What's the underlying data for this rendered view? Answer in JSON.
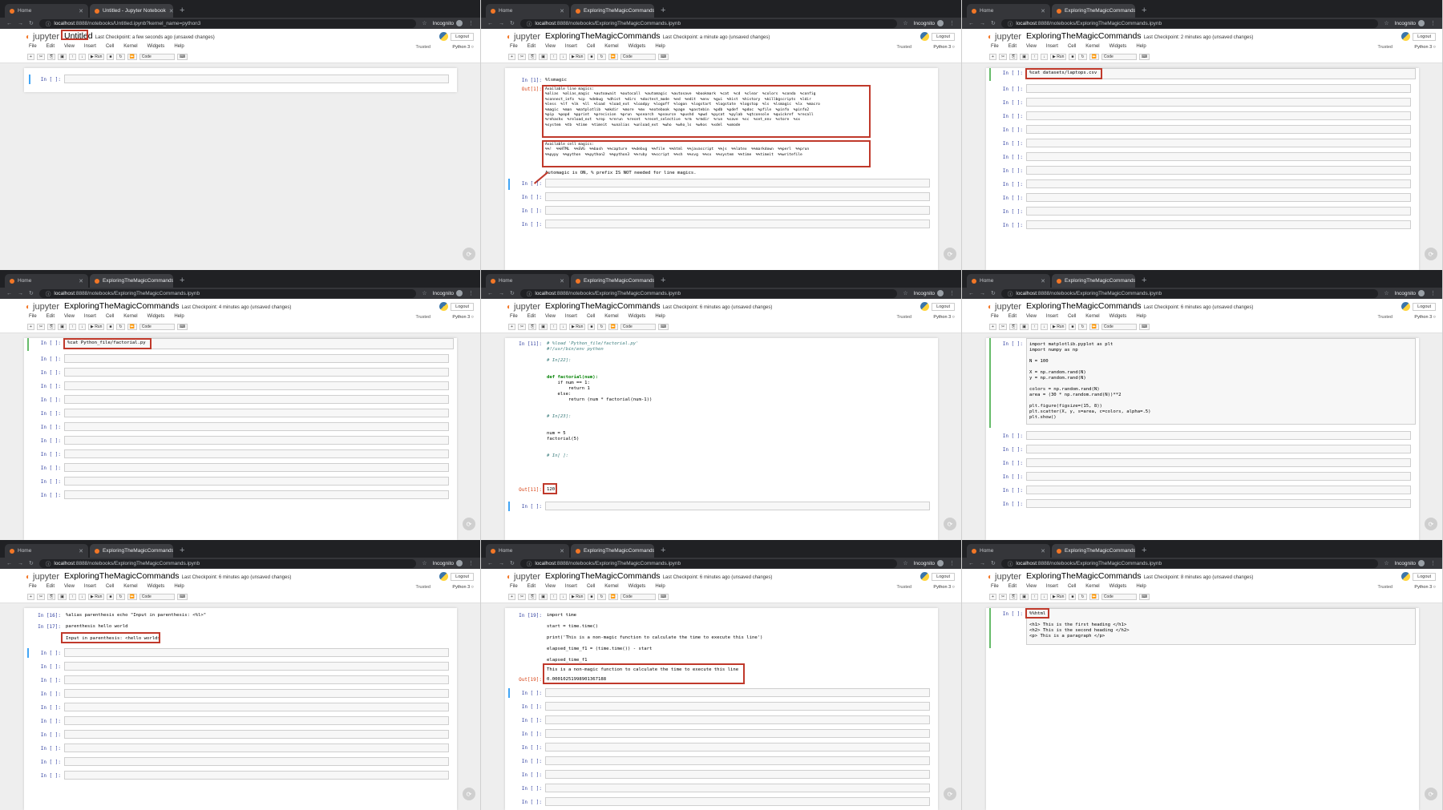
{
  "browser": {
    "home_tab": "Home",
    "new_tab": "+",
    "incognito": "Incognito",
    "host": "localhost",
    "url_rest": ":8888/notebooks/ExploringTheMagicCommands.ipynb",
    "url_untitled_rest": ":8888/notebooks/Untitled.ipynb?kernel_name=python3",
    "active_tab": "ExploringTheMagicCommands",
    "untitled_tab": "Untitled - Jupyter Notebook"
  },
  "jupyter": {
    "logo": "jupyter",
    "logout": "Logout",
    "trusted": "Trusted",
    "kernel": "Python 3",
    "menu": [
      "File",
      "Edit",
      "View",
      "Insert",
      "Cell",
      "Kernel",
      "Widgets",
      "Help"
    ],
    "toolbar": [
      "+",
      "✂",
      "⎘",
      "▣",
      "↑",
      "↓",
      "▶ Run",
      "■",
      "↻",
      "⏩"
    ],
    "cell_type": "Code",
    "unsaved": "(unsaved changes)",
    "empty_prompt": "In [ ]:"
  },
  "panels": [
    {
      "title": "Untitled",
      "checkpoint": "Last Checkpoint: a few seconds ago",
      "code": ""
    },
    {
      "title": "ExploringTheMagicCommands",
      "checkpoint": "Last Checkpoint: a minute ago",
      "in_prompt": "In [1]:",
      "out_prompt": "Out[1]:",
      "code": "%lsmagic",
      "output_line": "Available line magics:\n%alias  %alias_magic  %autoawait  %autocall  %automagic  %autosave  %bookmark  %cat  %cd  %clear  %colors  %conda  %config\n%connect_info  %cp  %debug  %dhist  %dirs  %doctest_mode  %ed  %edit  %env  %gui  %hist  %history  %killbgscripts  %ldir\n%less  %lf  %lk  %ll  %load  %load_ext  %loadpy  %logoff  %logon  %logstart  %logstate  %logstop  %ls  %lsmagic  %lx  %macro\n%magic  %man  %matplotlib  %mkdir  %more  %mv  %notebook  %page  %pastebin  %pdb  %pdef  %pdoc  %pfile  %pinfo  %pinfo2\n%pip  %popd  %pprint  %precision  %prun  %psearch  %psource  %pushd  %pwd  %pycat  %pylab  %qtconsole  %quickref  %recall\n%rehashx  %reload_ext  %rep  %rerun  %reset  %reset_selective  %rm  %rmdir  %run  %save  %sc  %set_env  %store  %sx\n%system  %tb  %time  %timeit  %unalias  %unload_ext  %who  %who_ls  %whos  %xdel  %xmode",
      "output_cell": "Available cell magics:\n%%!  %%HTML  %%SVG  %%bash  %%capture  %%debug  %%file  %%html  %%javascript  %%js  %%latex  %%markdown  %%perl  %%prun\n%%pypy  %%python  %%python2  %%python3  %%ruby  %%script  %%sh  %%svg  %%sx  %%system  %%time  %%timeit  %%writefile",
      "automagic": "Automagic is ON, % prefix IS NOT needed for line magics."
    },
    {
      "title": "ExploringTheMagicCommands",
      "checkpoint": "Last Checkpoint: 2 minutes ago",
      "code": "%cat datasets/laptops.csv"
    },
    {
      "title": "ExploringTheMagicCommands",
      "checkpoint": "Last Checkpoint: 4 minutes ago",
      "code": "%cat Python_file/factorial.py"
    },
    {
      "title": "ExploringTheMagicCommands",
      "checkpoint": "Last Checkpoint: 6 minutes ago",
      "in_prompt": "In [11]:",
      "out_prompt": "Out[11]:",
      "code_lines": [
        {
          "t": "# %load 'Python_file/factorial.py'",
          "c": "cm"
        },
        {
          "t": "#!/usr/bin/env python",
          "c": "cm"
        },
        {
          "t": "",
          "c": ""
        },
        {
          "t": "# In[22]:",
          "c": "cm"
        },
        {
          "t": "",
          "c": ""
        },
        {
          "t": "",
          "c": ""
        },
        {
          "t": "def factorial(num):",
          "c": "kw"
        },
        {
          "t": "    if num == 1:",
          "c": ""
        },
        {
          "t": "        return 1",
          "c": ""
        },
        {
          "t": "    else:",
          "c": ""
        },
        {
          "t": "        return (num * factorial(num-1))",
          "c": ""
        },
        {
          "t": "",
          "c": ""
        },
        {
          "t": "",
          "c": ""
        },
        {
          "t": "# In[23]:",
          "c": "cm"
        },
        {
          "t": "",
          "c": ""
        },
        {
          "t": "",
          "c": ""
        },
        {
          "t": "num = 5",
          "c": ""
        },
        {
          "t": "factorial(5)",
          "c": ""
        },
        {
          "t": "",
          "c": ""
        },
        {
          "t": "",
          "c": ""
        },
        {
          "t": "# In[ ]:",
          "c": "cm"
        }
      ],
      "output": "120"
    },
    {
      "title": "ExploringTheMagicCommands",
      "checkpoint": "Last Checkpoint: 6 minutes ago",
      "code": "import matplotlib.pyplot as plt\nimport numpy as np\n\nN = 100\n\nX = np.random.rand(N)\ny = np.random.rand(N)\n\ncolors = np.random.rand(N)\narea = (30 * np.random.rand(N))**2\n\nplt.figure(figsize=(15, 8))\nplt.scatter(X, y, s=area, c=colors, alpha=.5)\nplt.show()"
    },
    {
      "title": "ExploringTheMagicCommands",
      "checkpoint": "Last Checkpoint: 6 minutes ago",
      "in16": "In [16]:",
      "in17": "In [17]:",
      "code16": "%alias parenthesis echo \"Input in parenthesis: <%l>\"",
      "code17": "parenthesis hello world",
      "output": "Input in parenthesis: <hello world>"
    },
    {
      "title": "ExploringTheMagicCommands",
      "checkpoint": "Last Checkpoint: 6 minutes ago",
      "in_prompt": "In [19]:",
      "out_prompt": "Out[19]:",
      "code": "import time\n\nstart = time.time()\n\nprint('This is a non-magic function to calculate the time to execute this line')\n\nelapsed_time_f1 = (time.time()) - start\n\nelapsed_time_f1",
      "output_text": "This is a non-magic function to calculate the time to execute this line",
      "output_value": "0.00010251998901367188"
    },
    {
      "title": "ExploringTheMagicCommands",
      "checkpoint": "Last Checkpoint: 8 minutes ago",
      "code_magic": "%%html",
      "code_body": "<h1> This is the first heading </h1>\n<h2> This is the second heading </h2>\n<p> This is a paragraph </p>"
    }
  ]
}
